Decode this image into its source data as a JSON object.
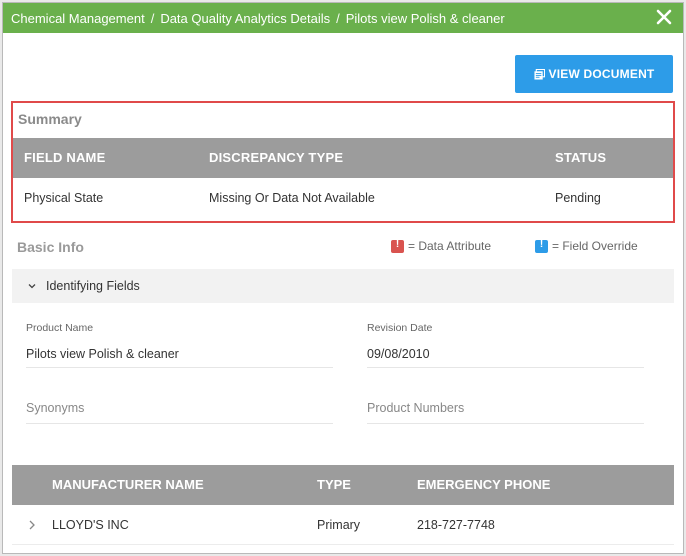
{
  "breadcrumb": {
    "items": [
      "Chemical Management",
      "Data Quality Analytics Details",
      "Pilots view Polish & cleaner"
    ],
    "separator": "/"
  },
  "close_label": "close",
  "toolbar": {
    "view_document_label": "VIEW DOCUMENT"
  },
  "summary": {
    "title": "Summary",
    "columns": [
      "FIELD NAME",
      "DISCREPANCY TYPE",
      "STATUS"
    ],
    "rows": [
      {
        "field_name": "Physical State",
        "discrepancy_type": "Missing Or Data Not Available",
        "status": "Pending"
      }
    ]
  },
  "basic_info": {
    "title": "Basic Info",
    "legend": {
      "data_attribute": {
        "label": "= Data Attribute",
        "color": "#d9534f",
        "icon": "exclamation-badge-icon"
      },
      "field_override": {
        "label": "= Field Override",
        "color": "#2d9ce8",
        "icon": "exclamation-badge-icon"
      }
    }
  },
  "identifying_fields": {
    "section_label": "Identifying Fields",
    "product_name": {
      "label": "Product Name",
      "value": "Pilots view Polish & cleaner"
    },
    "revision_date": {
      "label": "Revision Date",
      "value": "09/08/2010"
    },
    "synonyms": {
      "placeholder": "Synonyms"
    },
    "product_numbers": {
      "placeholder": "Product Numbers"
    }
  },
  "manufacturers": {
    "columns": [
      "MANUFACTURER NAME",
      "TYPE",
      "EMERGENCY PHONE"
    ],
    "rows": [
      {
        "name": "LLOYD'S INC",
        "type": "Primary",
        "phone": "218-727-7748"
      }
    ]
  },
  "colors": {
    "title_bar": "#6ab04c",
    "primary_button": "#2d9ce8",
    "table_header": "#9c9c9c",
    "highlight_border": "#e04a4a"
  }
}
